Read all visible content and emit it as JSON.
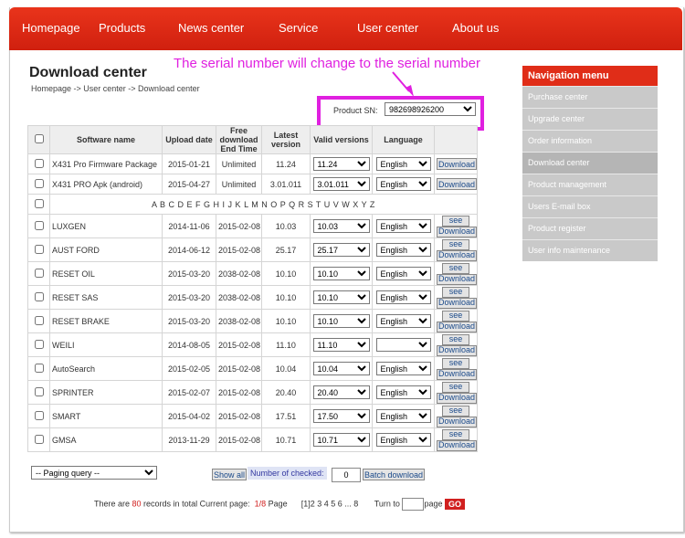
{
  "nav": [
    "Homepage",
    "Products",
    "News center",
    "Service",
    "User center",
    "About us"
  ],
  "title": "Download center",
  "breadcrumb": "Homepage -> User center -> Download center",
  "annotation": "The serial number will change to the serial number",
  "product_sn": {
    "label": "Product SN:",
    "value": "982698926200"
  },
  "table": {
    "headers": [
      "Software name",
      "Upload date",
      "Free download End Time",
      "Latest version",
      "Valid versions",
      "Language"
    ],
    "top_rows": [
      {
        "name": "X431 Pro Firmware Package",
        "upload": "2015-01-21",
        "end": "Unlimited",
        "latest": "11.24",
        "valid": "11.24",
        "lang": "English",
        "btn": "Download"
      },
      {
        "name": "X431 PRO Apk (android)",
        "upload": "2015-04-27",
        "end": "Unlimited",
        "latest": "3.01.011",
        "valid": "3.01.011",
        "lang": "English",
        "btn": "Download"
      }
    ],
    "alphabet": "A B C D E F G H I J K L M N O P Q R S T U V W X Y Z",
    "rows": [
      {
        "name": "LUXGEN",
        "upload": "2014-11-06",
        "end": "2015-02-08",
        "latest": "10.03",
        "valid": "10.03",
        "lang": "English"
      },
      {
        "name": "AUST FORD",
        "upload": "2014-06-12",
        "end": "2015-02-08",
        "latest": "25.17",
        "valid": "25.17",
        "lang": "English"
      },
      {
        "name": "RESET OIL",
        "upload": "2015-03-20",
        "end": "2038-02-08",
        "latest": "10.10",
        "valid": "10.10",
        "lang": "English"
      },
      {
        "name": "RESET SAS",
        "upload": "2015-03-20",
        "end": "2038-02-08",
        "latest": "10.10",
        "valid": "10.10",
        "lang": "English"
      },
      {
        "name": "RESET BRAKE",
        "upload": "2015-03-20",
        "end": "2038-02-08",
        "latest": "10.10",
        "valid": "10.10",
        "lang": "English"
      },
      {
        "name": "WEILI",
        "upload": "2014-08-05",
        "end": "2015-02-08",
        "latest": "11.10",
        "valid": "11.10",
        "lang": ""
      },
      {
        "name": "AutoSearch",
        "upload": "2015-02-05",
        "end": "2015-02-08",
        "latest": "10.04",
        "valid": "10.04",
        "lang": "English"
      },
      {
        "name": "SPRINTER",
        "upload": "2015-02-07",
        "end": "2015-02-08",
        "latest": "20.40",
        "valid": "20.40",
        "lang": "English"
      },
      {
        "name": "SMART",
        "upload": "2015-04-02",
        "end": "2015-02-08",
        "latest": "17.51",
        "valid": "17.50",
        "lang": "English"
      },
      {
        "name": "GMSA",
        "upload": "2013-11-29",
        "end": "2015-02-08",
        "latest": "10.71",
        "valid": "10.71",
        "lang": "English"
      }
    ],
    "see_label": "see",
    "download_label": "Download"
  },
  "controls": {
    "paging": "-- Paging query --",
    "show_all": "Show all",
    "num_checked_label": "Number of checked:",
    "num_checked_value": "0",
    "batch_download": "Batch download"
  },
  "footer": {
    "pre": "There are ",
    "count": "80",
    "mid": " records in total Current page:",
    "page": "1/8",
    "page_word": " Page",
    "pages": "[1]2 3 4 5 6 ... 8",
    "turn_to": "Turn to",
    "page_word2": "page",
    "go": "GO"
  },
  "sidenav": {
    "title": "Navigation menu",
    "items": [
      "Purchase center",
      "Upgrade center",
      "Order information",
      "Download center",
      "Product management",
      "Users E-mail box",
      "Product register",
      "User info maintenance"
    ],
    "active_index": 3
  },
  "colors": {
    "brand_red": "#e02d18",
    "annotation": "#e020e0"
  }
}
